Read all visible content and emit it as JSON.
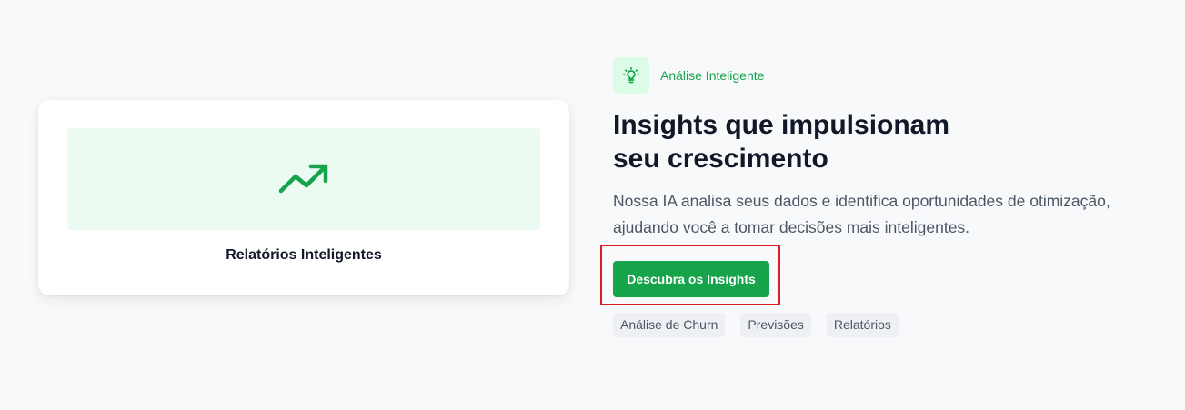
{
  "card": {
    "icon": "trending-up-icon",
    "title": "Relatórios Inteligentes"
  },
  "feature": {
    "badge_icon": "lightbulb-icon",
    "badge_label": "Análise Inteligente",
    "headline": "Insights que impulsionam seu crescimento",
    "description": "Nossa IA analisa seus dados e identifica oportunidades de otimização, ajudando você a tomar decisões mais inteligentes.",
    "cta_label": "Descubra os Insights",
    "tags": [
      "Análise de Churn",
      "Previsões",
      "Relatórios"
    ]
  },
  "colors": {
    "accent": "#16a34a",
    "accent_light": "#dcfce7",
    "highlight_border": "#e01b24"
  }
}
